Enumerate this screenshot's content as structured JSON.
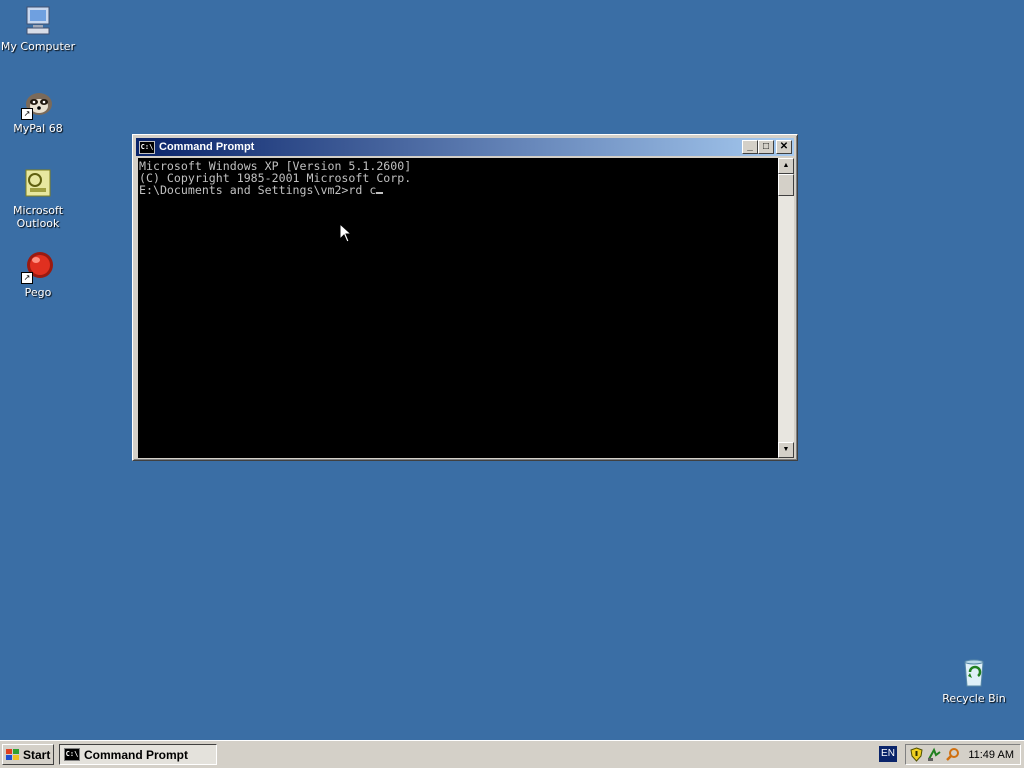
{
  "desktop": {
    "icons": [
      {
        "label": "My Computer"
      },
      {
        "label": "MyPal 68"
      },
      {
        "label": "Microsoft Outlook"
      },
      {
        "label": "Pego"
      },
      {
        "label": "Recycle Bin"
      }
    ]
  },
  "window": {
    "title": "Command Prompt",
    "icon_text": "C:\\",
    "buttons": {
      "minimize": "_",
      "maximize": "□",
      "close": "✕"
    },
    "console": {
      "lines": [
        "Microsoft Windows XP [Version 5.1.2600]",
        "(C) Copyright 1985-2001 Microsoft Corp.",
        "",
        "E:\\Documents and Settings\\vm2>rd c"
      ]
    }
  },
  "taskbar": {
    "start_label": "Start",
    "task_label": "Command Prompt",
    "task_icon_text": "C:\\",
    "language": "EN",
    "clock": "11:49 AM"
  },
  "colors": {
    "desktop": "#3a6ea5",
    "title_active_start": "#0a246a",
    "title_active_end": "#a6caf0",
    "console_bg": "#000000",
    "console_fg": "#c0c0c0"
  }
}
